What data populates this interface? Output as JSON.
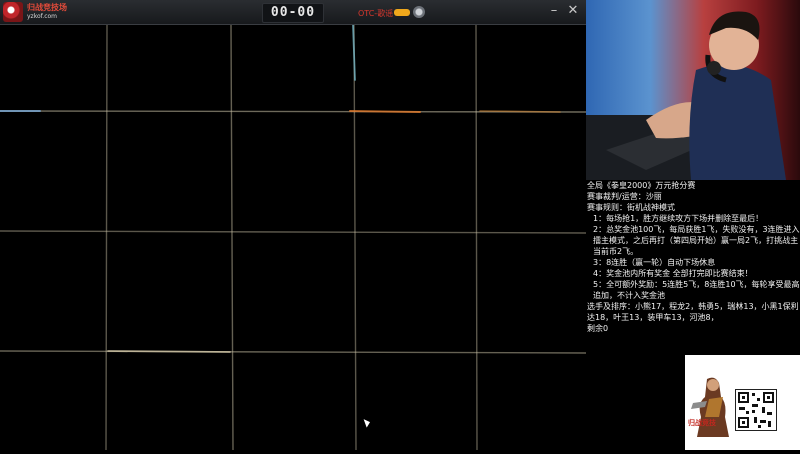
{
  "titlebar": {
    "logo_title": "归战竞技场",
    "logo_site": "yzkof.com",
    "blue_team": "",
    "score": "00-00",
    "red_team": "OTC-歌谣",
    "red_tail": ""
  },
  "info_lines": [
    {
      "text": "全局《拳皇2000》万元抢分赛",
      "indent": false
    },
    {
      "text": "赛事裁判/运营：沙丽",
      "indent": false
    },
    {
      "text": "赛事规则：街机战神模式",
      "indent": false
    },
    {
      "text": "1：每场抢1，胜方继续攻方下场并删除至最后！",
      "indent": true
    },
    {
      "text": "2：总奖金池100飞，每局获胜1飞，失败没有，3连胜进入擂主模式，之后再打（第四局开始）赢一局2飞，打挑战主当前币2飞。",
      "indent": true
    },
    {
      "text": "3：8连胜（赢一轮）自动下场休息",
      "indent": true
    },
    {
      "text": "4：奖金池内所有奖金 全部打完即比赛结束！",
      "indent": true
    },
    {
      "text": "5：全可额外奖励：5连胜5飞，8连胜10飞，每轮享受最高追加，不计入奖金池",
      "indent": true
    },
    {
      "text": "选手及排序：小熊17，程龙2，韩勇5，瑞林13，小黑1保利达18，叶王13，装甲车13，河池8，",
      "indent": false
    },
    {
      "text": "剩余0",
      "indent": false
    }
  ],
  "qr_panel": {
    "side_text": "归战竞技"
  },
  "colors": {
    "red_accent": "#d8372d",
    "blue_accent": "#3f7fe0",
    "badge_gold": "#f0a81c",
    "grid_lines_color": "#c9c1a6"
  }
}
